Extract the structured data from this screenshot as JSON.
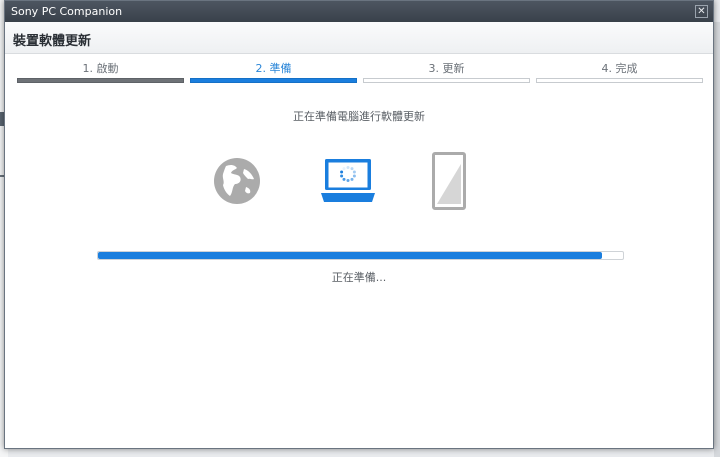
{
  "window": {
    "title": "Sony PC Companion",
    "close_symbol": "✕"
  },
  "header": {
    "title": "裝置軟體更新"
  },
  "steps": [
    {
      "label": "1. 啟動",
      "state": "done"
    },
    {
      "label": "2. 準備",
      "state": "active"
    },
    {
      "label": "3. 更新",
      "state": "pending"
    },
    {
      "label": "4. 完成",
      "state": "pending"
    }
  ],
  "main": {
    "status_text": "正在準備電腦進行軟體更新",
    "icons": [
      "globe-icon",
      "laptop-loading-icon",
      "phone-icon"
    ],
    "progress_value": 0.96,
    "progress_text": "正在準備..."
  },
  "colors": {
    "accent": "#1a7ede",
    "done": "#6e7277",
    "icon_gray": "#ababab"
  }
}
